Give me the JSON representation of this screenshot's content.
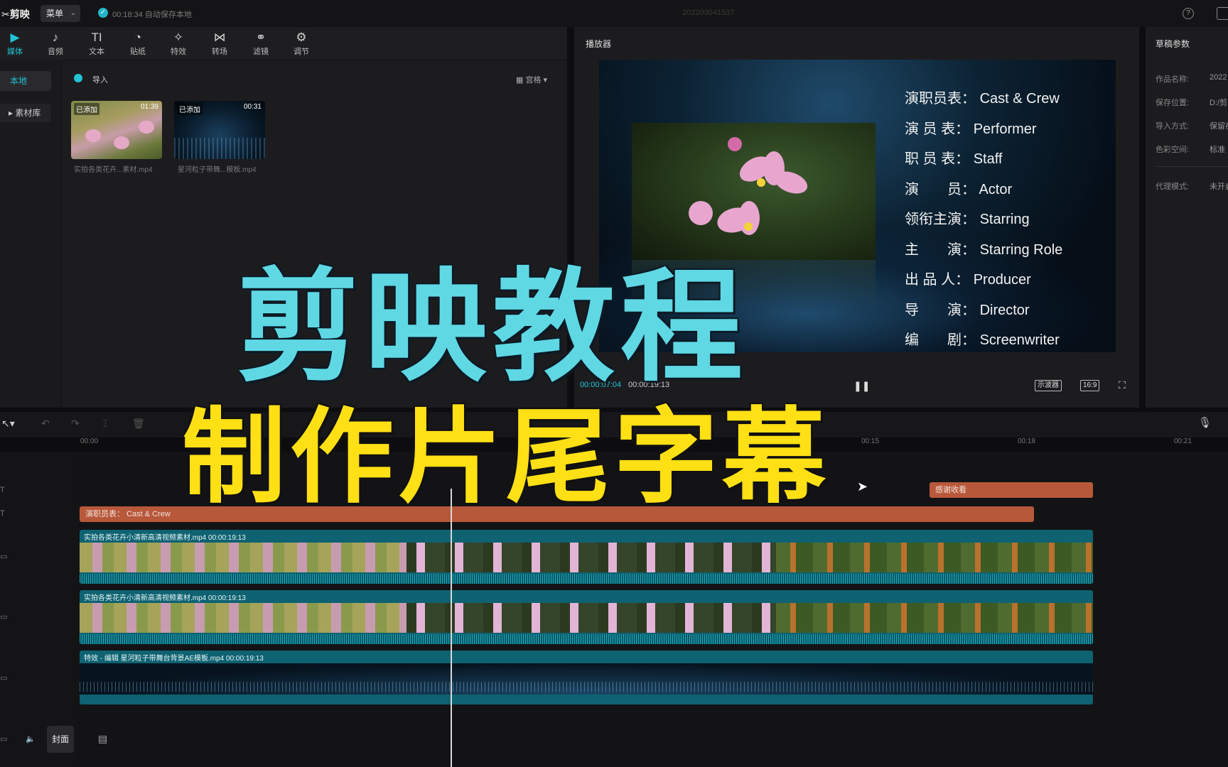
{
  "titlebar": {
    "app_name": "剪映",
    "menu_label": "菜单",
    "autosave": "00:18:34 自动保存本地",
    "project_name": "202203041537",
    "help_icon": "question-circle-icon",
    "layout_icon": "layout-icon"
  },
  "toolbar": {
    "tools": [
      {
        "label": "媒体",
        "icon": "▶",
        "active": true
      },
      {
        "label": "音频",
        "icon": "♪",
        "active": false
      },
      {
        "label": "文本",
        "icon": "TI",
        "active": false
      },
      {
        "label": "贴纸",
        "icon": "◔",
        "active": false
      },
      {
        "label": "特效",
        "icon": "✧",
        "active": false
      },
      {
        "label": "转场",
        "icon": "⋈",
        "active": false
      },
      {
        "label": "滤镜",
        "icon": "⚭",
        "active": false
      },
      {
        "label": "调节",
        "icon": "⚙",
        "active": false
      }
    ]
  },
  "media": {
    "side_local": "本地",
    "side_library": "素材库",
    "import_label": "导入",
    "sort_label": "宫格",
    "items": [
      {
        "badge": "已添加",
        "duration": "01:39",
        "name": "实拍各类花卉...素材.mp4"
      },
      {
        "badge": "已添加",
        "duration": "00:31",
        "name": "星河粒子带舞...模板.mp4"
      }
    ]
  },
  "player": {
    "title": "播放器",
    "credits": [
      {
        "key": "演职员表：",
        "value": "Cast & Crew"
      },
      {
        "key": "演 员 表：",
        "value": "Performer"
      },
      {
        "key": "职 员 表：",
        "value": "Staff"
      },
      {
        "key": "演　　员：",
        "value": "Actor"
      },
      {
        "key": "领衔主演：",
        "value": "Starring"
      },
      {
        "key": "主　　演：",
        "value": "Starring Role"
      },
      {
        "key": "出 品 人：",
        "value": "Producer"
      },
      {
        "key": "导　　演：",
        "value": "Director"
      },
      {
        "key": "编　　剧：",
        "value": "Screenwriter"
      }
    ],
    "time_current": "00:00:07:04",
    "time_total": "00:00:19:13",
    "btn_scope": "示波器",
    "btn_ratio": "16:9"
  },
  "draft": {
    "title": "草稿参数",
    "fields": [
      {
        "label": "作品名称:",
        "value": "2022"
      },
      {
        "label": "保存位置:",
        "value": "D:/剪"
      },
      {
        "label": "导入方式:",
        "value": "保留在"
      },
      {
        "label": "色彩空间:",
        "value": "标准"
      }
    ],
    "proxy_label": "代理模式:",
    "proxy_value": "未开启"
  },
  "timeline": {
    "ticks": [
      "00:00",
      "00:15",
      "00:18",
      "00:21"
    ],
    "text_clip_thanks": "感谢收看",
    "text_clip_credits": "演职员表：  Cast & Crew",
    "video_clip_1": "实拍各类花卉小清新高清视频素材.mp4     00:00:19:13",
    "video_clip_2": "实拍各类花卉小清新高清视频素材.mp4     00:00:19:13",
    "bg_clip": "特效 - 编辑     星河粒子带舞台背景AE模板.mp4     00:00:19:13",
    "cover_label": "封面"
  },
  "overlay": {
    "line1": "剪映教程",
    "line2": "制作片尾字幕"
  }
}
